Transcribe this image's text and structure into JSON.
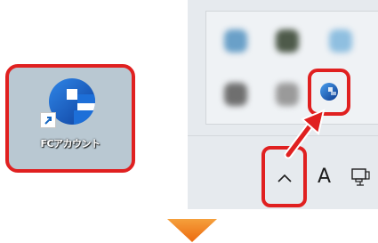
{
  "desktop_shortcut": {
    "label": "FCアカウント",
    "icon": "fc-account-app-icon",
    "overlay_icon": "shortcut-arrow-icon"
  },
  "tray": {
    "hidden_icons_button": {
      "icon": "chevron-up-icon"
    },
    "ime_indicator": "A",
    "network_icon": "network-icon",
    "app_icon": "fc-account-tray-icon"
  },
  "colors": {
    "highlight": "#e02020",
    "app_blue": "#1a5fb8",
    "down_arrow": "#f07a14"
  }
}
